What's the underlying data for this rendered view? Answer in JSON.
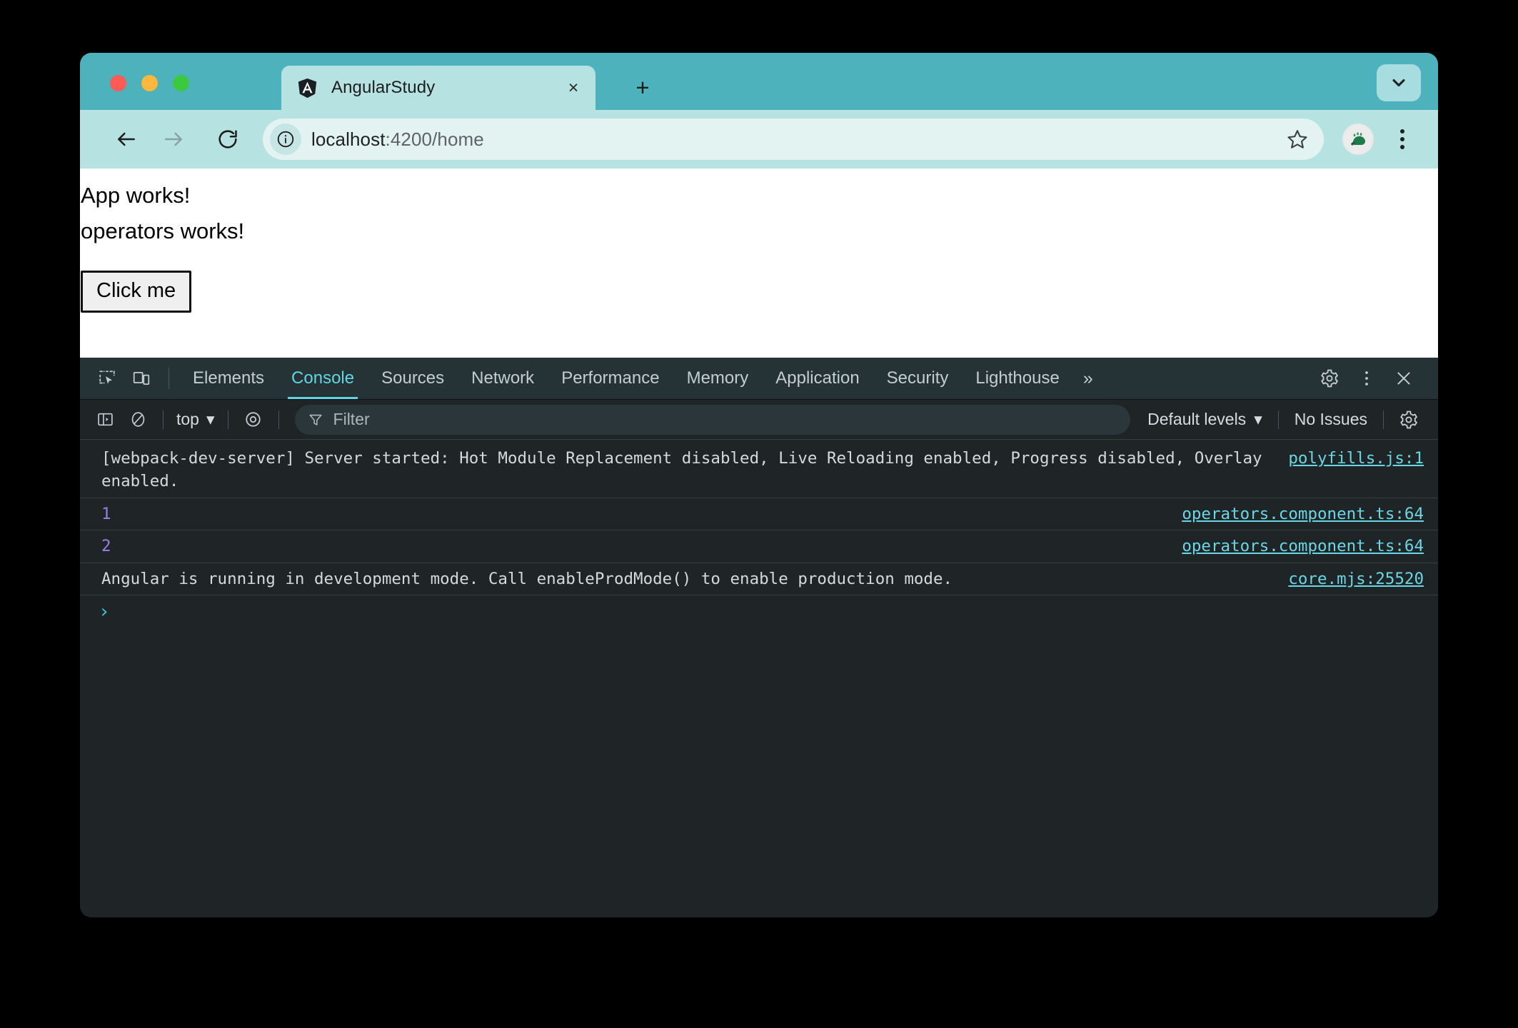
{
  "browser": {
    "window_controls": [
      "close",
      "minimize",
      "maximize"
    ],
    "tab": {
      "title": "AngularStudy",
      "favicon": "angular-logo-icon",
      "close_label": "×"
    },
    "new_tab_label": "+",
    "window_chevron": "chevron-down-icon",
    "nav": {
      "back": "back-arrow-icon",
      "forward": "forward-arrow-icon",
      "reload": "reload-icon"
    },
    "omnibox": {
      "site_info_icon": "info-circle-icon",
      "url_host": "localhost",
      "url_rest": ":4200/home",
      "url_full": "localhost:4200/home",
      "bookmark_icon": "star-icon"
    },
    "profile_avatar": "dinosaur-avatar-icon",
    "menu_icon": "three-dot-menu-icon"
  },
  "page": {
    "line1": "App works!",
    "line2": "operators works!",
    "button_label": "Click me"
  },
  "devtools": {
    "left_icons": [
      "inspect-element-icon",
      "device-toolbar-icon"
    ],
    "tabs": [
      {
        "label": "Elements",
        "active": false
      },
      {
        "label": "Console",
        "active": true
      },
      {
        "label": "Sources",
        "active": false
      },
      {
        "label": "Network",
        "active": false
      },
      {
        "label": "Performance",
        "active": false
      },
      {
        "label": "Memory",
        "active": false
      },
      {
        "label": "Application",
        "active": false
      },
      {
        "label": "Security",
        "active": false
      },
      {
        "label": "Lighthouse",
        "active": false
      }
    ],
    "more_tabs_label": "»",
    "settings_icon": "gear-icon",
    "more_options_icon": "three-dot-vertical-icon",
    "close_icon": "close-x-icon",
    "filterbar": {
      "sidebar_toggle_icon": "console-sidebar-icon",
      "clear_console_icon": "clear-console-icon",
      "context_label": "top",
      "context_caret": "▾",
      "live_expression_icon": "eye-icon",
      "filter_icon": "filter-funnel-icon",
      "filter_value": "",
      "filter_placeholder": "Filter",
      "levels_label": "Default levels",
      "levels_caret": "▾",
      "issues_label": "No Issues",
      "console_settings_icon": "gear-icon"
    },
    "messages": [
      {
        "text": "[webpack-dev-server] Server started: Hot Module Replacement disabled, Live Reloading enabled, Progress disabled, Overlay enabled.",
        "source": "polyfills.js:1",
        "kind": "text"
      },
      {
        "text": "1",
        "source": "operators.component.ts:64",
        "kind": "number"
      },
      {
        "text": "2",
        "source": "operators.component.ts:64",
        "kind": "number"
      },
      {
        "text": "Angular is running in development mode. Call enableProdMode() to enable production mode.",
        "source": "core.mjs:25520",
        "kind": "text"
      }
    ],
    "prompt_caret": "›"
  }
}
